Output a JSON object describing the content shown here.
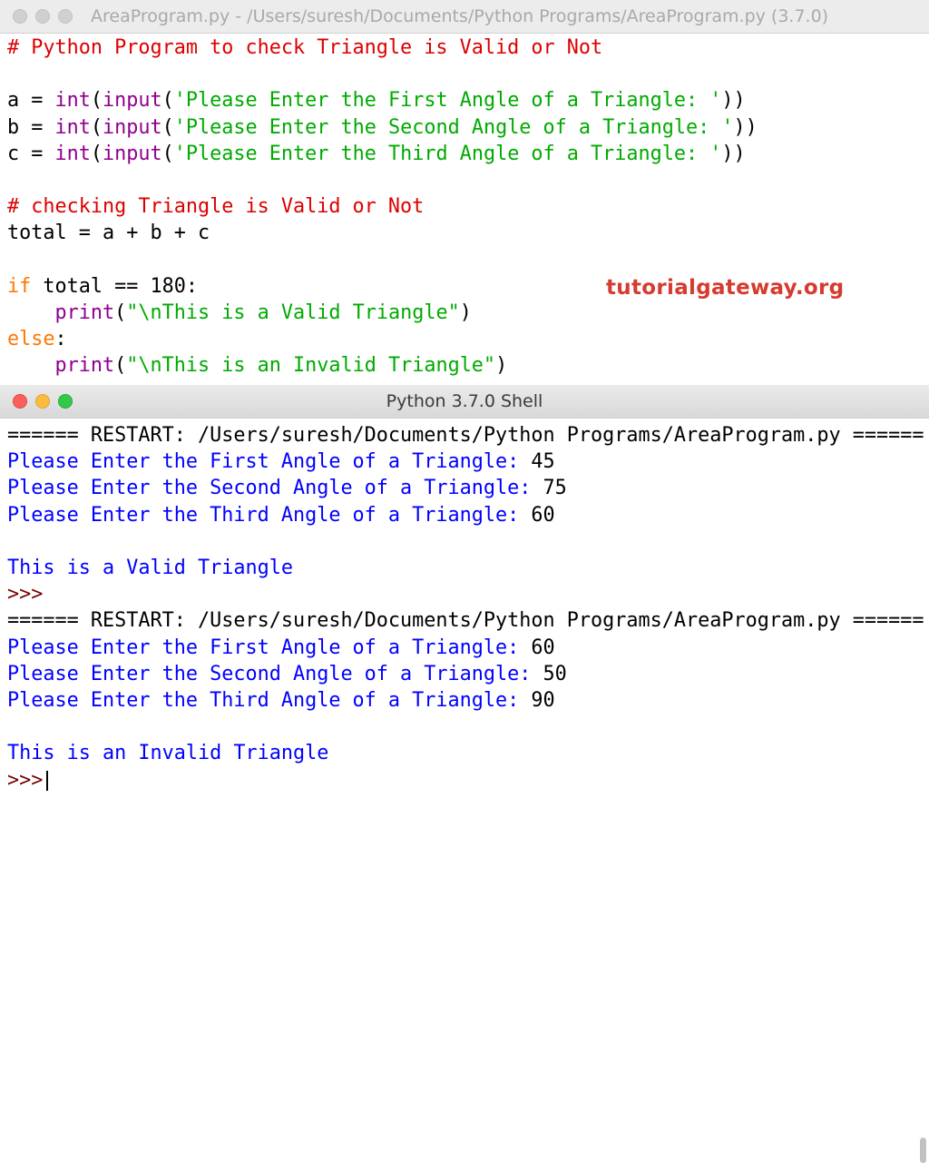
{
  "editor": {
    "title": "AreaProgram.py - /Users/suresh/Documents/Python Programs/AreaProgram.py (3.7.0)",
    "lines": [
      "# Python Program to check Triangle is Valid or Not",
      "",
      "a = int(input('Please Enter the First Angle of a Triangle: '))",
      "b = int(input('Please Enter the Second Angle of a Triangle: '))",
      "c = int(input('Please Enter the Third Angle of a Triangle: '))",
      "",
      "# checking Triangle is Valid or Not",
      "total = a + b + c",
      "",
      "if total == 180:",
      "    print(\"\\nThis is a Valid Triangle\")",
      "else:",
      "    print(\"\\nThis is an Invalid Triangle\")"
    ],
    "watermark": "tutorialgateway.org"
  },
  "shell": {
    "title": "Python 3.7.0 Shell",
    "restart": "====== RESTART: /Users/suresh/Documents/Python Programs/AreaProgram.py ======",
    "run1": {
      "p1": "Please Enter the First Angle of a Triangle: ",
      "v1": "45",
      "p2": "Please Enter the Second Angle of a Triangle: ",
      "v2": "75",
      "p3": "Please Enter the Third Angle of a Triangle: ",
      "v3": "60",
      "result": "This is a Valid Triangle"
    },
    "prompt": ">>>",
    "run2": {
      "p1": "Please Enter the First Angle of a Triangle: ",
      "v1": "60",
      "p2": "Please Enter the Second Angle of a Triangle: ",
      "v2": "50",
      "p3": "Please Enter the Third Angle of a Triangle: ",
      "v3": "90",
      "result": "This is an Invalid Triangle"
    }
  },
  "colors": {
    "comment": "#dd0000",
    "builtin": "#900090",
    "string": "#00aa00",
    "keyword": "#ff7700",
    "output": "#0000ff",
    "prompt": "#770000"
  }
}
